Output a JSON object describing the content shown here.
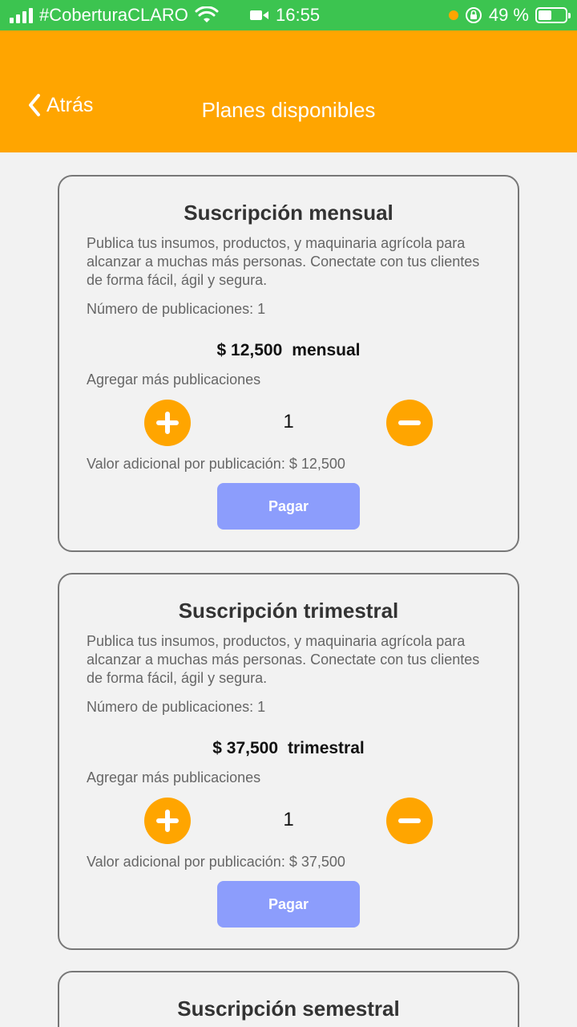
{
  "status_bar": {
    "carrier": "#CoberturaCLARO",
    "time": "16:55",
    "battery": "49 %",
    "battery_level": 0.49
  },
  "header": {
    "back_label": "Atrás",
    "title": "Planes disponibles",
    "color": "#ffa500"
  },
  "plans": [
    {
      "title": "Suscripción mensual",
      "description": "Publica tus insumos, productos, y maquinaria agrícola para alcanzar a muchas más personas. Conectate con tus clientes de forma fácil, ágil y segura.",
      "publications": "Número de publicaciones: 1",
      "price": "$ 12,500",
      "period": "mensual",
      "add_label": "Agregar más publicaciones",
      "quantity": "1",
      "extra_value": "Valor adicional por publicación: $ 12,500",
      "pay_label": "Pagar"
    },
    {
      "title": "Suscripción trimestral",
      "description": "Publica tus insumos, productos, y maquinaria agrícola para alcanzar a muchas más personas. Conectate con tus clientes de forma fácil, ágil y segura.",
      "publications": "Número de publicaciones: 1",
      "price": "$ 37,500",
      "period": "trimestral",
      "add_label": "Agregar más publicaciones",
      "quantity": "1",
      "extra_value": "Valor adicional por publicación: $ 37,500",
      "pay_label": "Pagar"
    },
    {
      "title": "Suscripción semestral"
    }
  ],
  "colors": {
    "accent": "#ffa500",
    "pay_button": "#8c9dfc",
    "status_bar": "#3cc450"
  }
}
